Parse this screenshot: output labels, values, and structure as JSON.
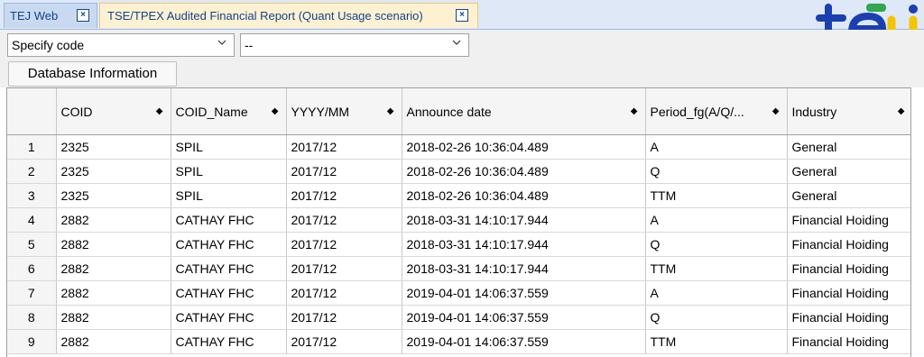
{
  "tabs": [
    {
      "label": "TEJ Web",
      "close": "×"
    },
    {
      "label": "TSE/TPEX Audited Financial Report (Quant Usage scenario)",
      "close": "×"
    }
  ],
  "logo": {
    "name": "tej-logo",
    "colors": [
      "#1a3fb0",
      "#f4c400",
      "#2fa84f"
    ]
  },
  "toolbar": {
    "code_select": "Specify code",
    "second_select": "--",
    "db_info_button": "Database Information"
  },
  "table": {
    "columns": [
      "COID",
      "COID_Name",
      "YYYY/MM",
      "Announce date",
      "Period_fg(A/Q/...",
      "Industry"
    ],
    "sort_glyph": "◆",
    "rows": [
      [
        "1",
        "2325",
        "SPIL",
        "2017/12",
        "2018-02-26 10:36:04.489",
        "A",
        "General"
      ],
      [
        "2",
        "2325",
        "SPIL",
        "2017/12",
        "2018-02-26 10:36:04.489",
        "Q",
        "General"
      ],
      [
        "3",
        "2325",
        "SPIL",
        "2017/12",
        "2018-02-26 10:36:04.489",
        "TTM",
        "General"
      ],
      [
        "4",
        "2882",
        "CATHAY FHC",
        "2017/12",
        "2018-03-31 14:10:17.944",
        "A",
        "Financial Hoiding"
      ],
      [
        "5",
        "2882",
        "CATHAY FHC",
        "2017/12",
        "2018-03-31 14:10:17.944",
        "Q",
        "Financial Hoiding"
      ],
      [
        "6",
        "2882",
        "CATHAY FHC",
        "2017/12",
        "2018-03-31 14:10:17.944",
        "TTM",
        "Financial Hoiding"
      ],
      [
        "7",
        "2882",
        "CATHAY FHC",
        "2017/12",
        "2019-04-01 14:06:37.559",
        "A",
        "Financial Hoiding"
      ],
      [
        "8",
        "2882",
        "CATHAY FHC",
        "2017/12",
        "2019-04-01 14:06:37.559",
        "Q",
        "Financial Hoiding"
      ],
      [
        "9",
        "2882",
        "CATHAY FHC",
        "2017/12",
        "2019-04-01 14:06:37.559",
        "TTM",
        "Financial Hoiding"
      ]
    ]
  }
}
